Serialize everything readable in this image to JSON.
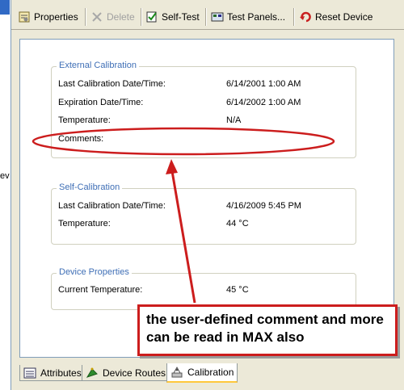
{
  "left_pane": {
    "cut_text": "ev"
  },
  "toolbar": {
    "buttons": [
      {
        "label": "Properties",
        "icon": "properties-icon",
        "enabled": true
      },
      {
        "label": "Delete",
        "icon": "delete-icon",
        "enabled": false
      },
      {
        "label": "Self-Test",
        "icon": "self-test-icon",
        "enabled": true
      },
      {
        "label": "Test Panels...",
        "icon": "test-panels-icon",
        "enabled": true
      },
      {
        "label": "Reset Device",
        "icon": "reset-device-icon",
        "enabled": true
      }
    ]
  },
  "external_calibration": {
    "title": "External Calibration",
    "rows": [
      {
        "label": "Last Calibration Date/Time:",
        "value": "6/14/2001 1:00 AM"
      },
      {
        "label": "Expiration Date/Time:",
        "value": "6/14/2002 1:00 AM"
      },
      {
        "label": "Temperature:",
        "value": "N/A"
      },
      {
        "label": "Comments:",
        "value": ""
      }
    ]
  },
  "self_calibration": {
    "title": "Self-Calibration",
    "rows": [
      {
        "label": "Last Calibration Date/Time:",
        "value": "4/16/2009 5:45 PM"
      },
      {
        "label": "Temperature:",
        "value": "44 °C"
      }
    ]
  },
  "device_properties": {
    "title": "Device Properties",
    "rows": [
      {
        "label": "Current Temperature:",
        "value": "45 °C"
      }
    ]
  },
  "annotation": {
    "text": "the user-defined comment and more can be read in MAX also",
    "color": "#cc1d1d"
  },
  "tabs": [
    {
      "label": "Attributes",
      "icon": "attributes-icon",
      "active": false
    },
    {
      "label": "Device Routes",
      "icon": "device-routes-icon",
      "active": false
    },
    {
      "label": "Calibration",
      "icon": "calibration-icon",
      "active": true
    }
  ]
}
